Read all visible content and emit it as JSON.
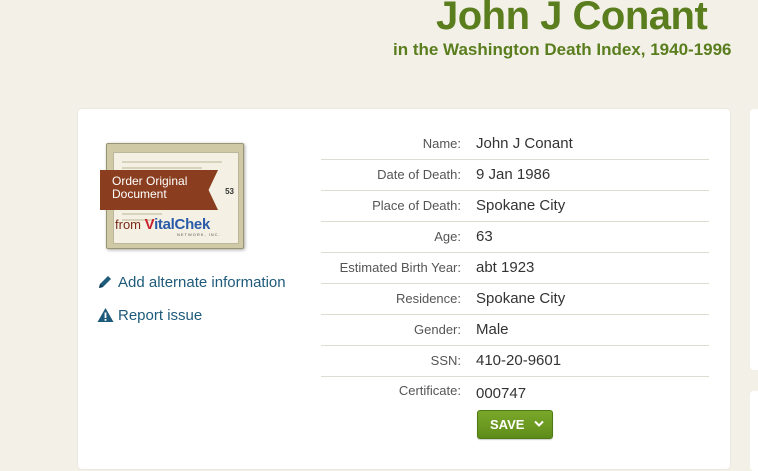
{
  "header": {
    "title": "John J Conant",
    "subtitle": "in the Washington Death Index, 1940-1996"
  },
  "document": {
    "ribbon_line1": "Order Original",
    "ribbon_line2": "Document",
    "from_label": "from",
    "brand_v": "V",
    "brand_rest": "italChek",
    "brand_sub": "NETWORK, INC.",
    "doc_number": "53"
  },
  "actions": {
    "edit_label": "Add alternate information",
    "edit_icon": "pencil-icon",
    "report_label": "Report issue",
    "report_icon": "warning-icon"
  },
  "record": [
    {
      "label": "Name:",
      "value": "John J Conant"
    },
    {
      "label": "Date of Death:",
      "value": "9 Jan 1986"
    },
    {
      "label": "Place of Death:",
      "value": "Spokane City"
    },
    {
      "label": "Age:",
      "value": "63"
    },
    {
      "label": "Estimated Birth Year:",
      "value": "abt 1923"
    },
    {
      "label": "Residence:",
      "value": "Spokane City"
    },
    {
      "label": "Gender:",
      "value": "Male"
    },
    {
      "label": "SSN:",
      "value": "410-20-9601"
    },
    {
      "label": "Certificate:",
      "value": "000747"
    }
  ],
  "save_button": {
    "label": "SAVE",
    "icon": "chevron-down-icon"
  },
  "colors": {
    "title_green": "#5a7d1e",
    "link_blue": "#1e5a7a",
    "save_green": "#6b9a22",
    "ribbon_brown": "#8a3e1f"
  }
}
